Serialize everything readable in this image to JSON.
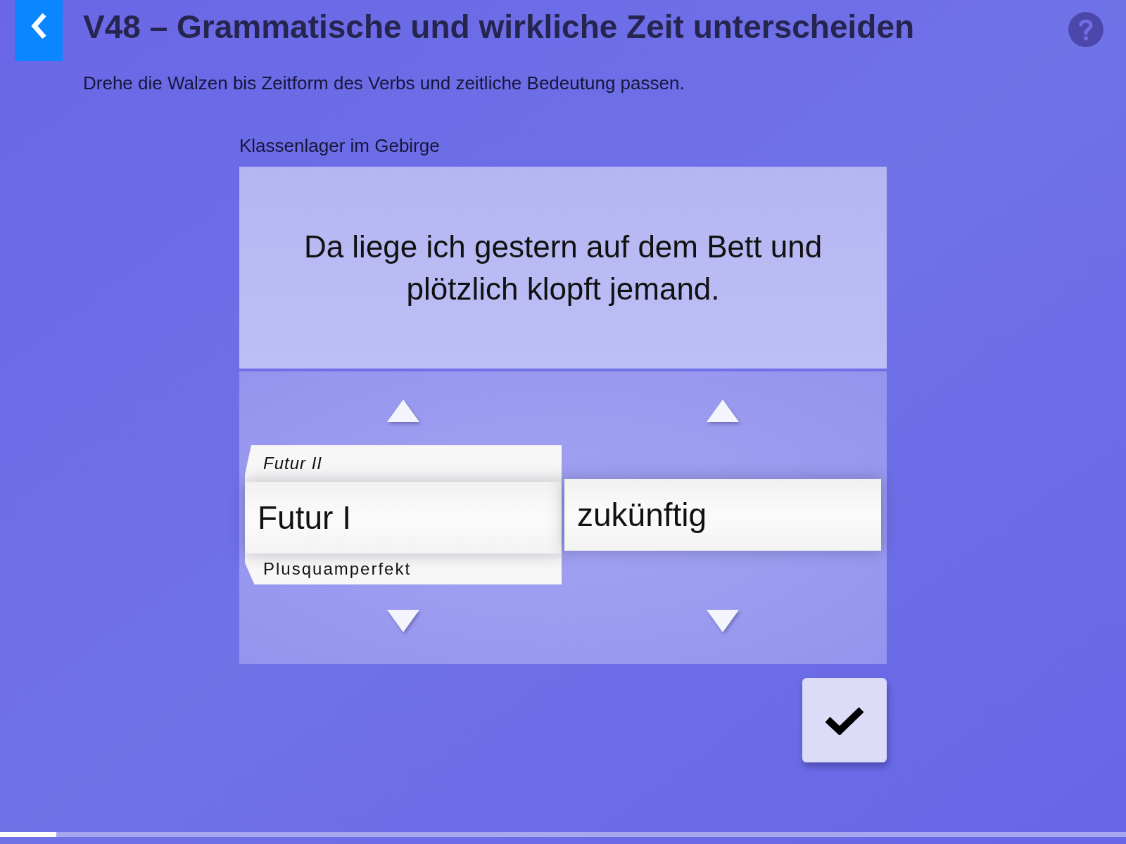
{
  "header": {
    "title": "V48 – Grammatische und wirkliche Zeit unterscheiden",
    "instruction": "Drehe die Walzen bis Zeitform des Verbs und zeitliche Bedeutung passen."
  },
  "exercise": {
    "heading": "Klassenlager im Gebirge",
    "sentence": "Da liege ich gestern auf dem Bett und plötzlich klopft jemand."
  },
  "reels": [
    {
      "items": [
        {
          "label": "Futur II",
          "selected": false
        },
        {
          "label": "Futur I",
          "selected": true
        },
        {
          "label": "Plusquamperfekt",
          "selected": false
        }
      ]
    },
    {
      "items": [
        {
          "label": "zukünftig",
          "selected": true
        }
      ]
    }
  ],
  "progress": {
    "level": 0.05
  }
}
